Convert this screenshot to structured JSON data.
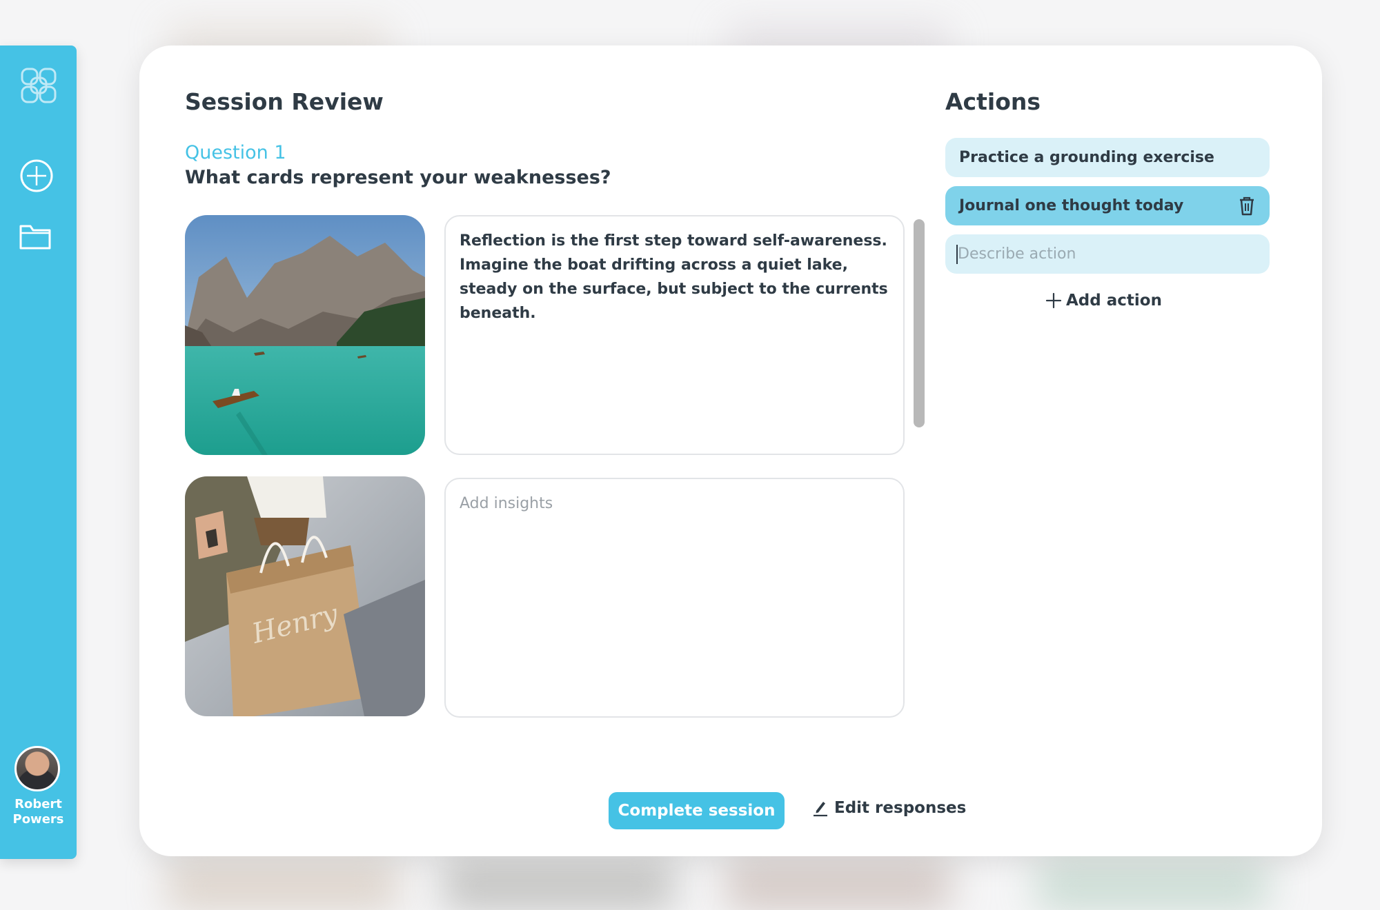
{
  "sidebar": {
    "user_first": "Robert",
    "user_last": "Powers"
  },
  "review": {
    "title": "Session Review",
    "question_number": "Question 1",
    "question_text": "What cards represent your weaknesses?",
    "cards": [
      {
        "image": "mountain-lake-boat-photo",
        "text": "Reflection is the first step toward self-awareness. Imagine the boat drifting across a quiet lake, steady on the surface, but subject to the currents beneath.",
        "placeholder": ""
      },
      {
        "image": "shopping-bag-photo",
        "text": "",
        "placeholder": "Add insights"
      }
    ]
  },
  "actions": {
    "title": "Actions",
    "items": [
      {
        "label": "Practice a grounding exercise"
      },
      {
        "label": "Journal one thought today"
      }
    ],
    "input_placeholder": "Describe action",
    "add_label": "Add action"
  },
  "footer": {
    "complete_label": "Complete session",
    "edit_label": "Edit responses"
  },
  "colors": {
    "accent": "#45c2e5",
    "action_light": "#daf1f8",
    "action_selected": "#7fd2ea",
    "text": "#2f3b45"
  }
}
